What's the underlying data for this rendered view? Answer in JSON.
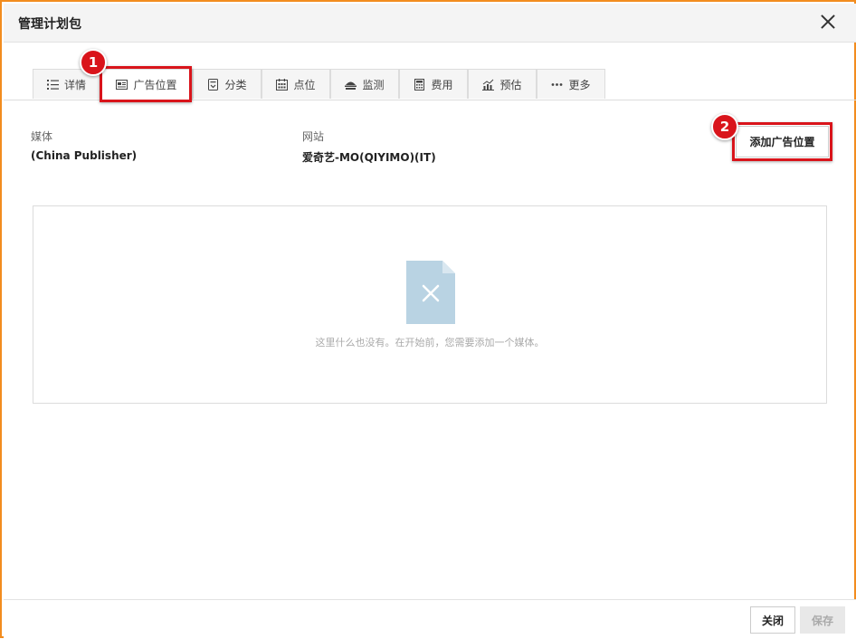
{
  "dialog": {
    "title": "管理计划包"
  },
  "tabs": [
    {
      "label": "详情",
      "icon": "list-icon"
    },
    {
      "label": "广告位置",
      "icon": "ad-placement-icon",
      "active": true
    },
    {
      "label": "分类",
      "icon": "category-icon"
    },
    {
      "label": "点位",
      "icon": "calendar-icon"
    },
    {
      "label": "监测",
      "icon": "monitor-icon"
    },
    {
      "label": "费用",
      "icon": "calculator-icon"
    },
    {
      "label": "预估",
      "icon": "chart-icon"
    },
    {
      "label": "更多",
      "icon": "more-dots-icon"
    }
  ],
  "annotations": {
    "step1": "1",
    "step2": "2",
    "highlight_color": "#d9141b"
  },
  "fields": {
    "media_label": "媒体",
    "media_value": "(China Publisher)",
    "site_label": "网站",
    "site_value": "爱奇艺-MO(QIYIMO)(IT)"
  },
  "actions": {
    "add_placement": "添加广告位置"
  },
  "empty_state": {
    "message": "这里什么也没有。在开始前，您需要添加一个媒体。"
  },
  "footer": {
    "close": "关闭",
    "save": "保存"
  },
  "colors": {
    "frame_border": "#f28c1e",
    "empty_icon": "#b9d3e3"
  }
}
